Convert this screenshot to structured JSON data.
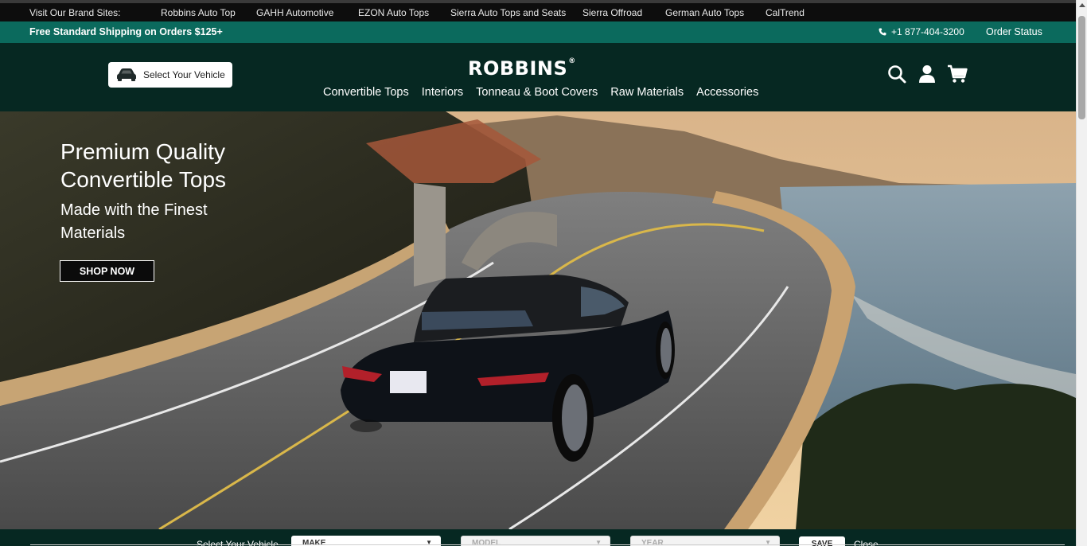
{
  "brand_bar": {
    "label": "Visit Our Brand Sites:",
    "links": [
      "Robbins Auto Top",
      "GAHH Automotive",
      "EZON Auto Tops",
      "Sierra Auto Tops and Seats",
      "Sierra Offroad",
      "German Auto Tops",
      "CalTrend"
    ]
  },
  "ship_bar": {
    "shipping_text": "Free Standard Shipping on Orders $125+",
    "phone": "+1 877-404-3200",
    "order_status": "Order Status"
  },
  "header": {
    "select_vehicle": "Select Your Vehicle",
    "logo": "ROBBINS",
    "logo_mark": "®",
    "nav": [
      "Convertible Tops",
      "Interiors",
      "Tonneau & Boot Covers",
      "Raw Materials",
      "Accessories"
    ],
    "icons": [
      "search-icon",
      "account-icon",
      "cart-icon"
    ]
  },
  "hero": {
    "title": "Premium Quality Convertible Tops",
    "subtitle": "Made with the Finest Materials",
    "cta": "SHOP NOW"
  },
  "selector": {
    "label": "Select Your Vehicle",
    "make": "MAKE",
    "model": "MODEL",
    "year": "YEAR",
    "save": "SAVE",
    "close": "Close"
  },
  "colors": {
    "brand_bar_bg": "#0d0d0d",
    "shipping_bar_bg": "#0b6a5d",
    "header_bg": "#062822"
  }
}
